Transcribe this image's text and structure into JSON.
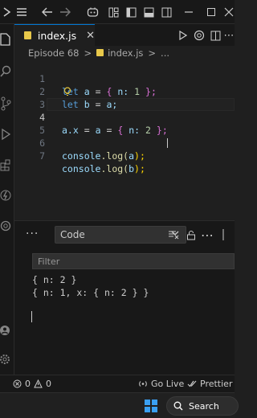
{
  "tab": {
    "filename": "index.js"
  },
  "breadcrumb": {
    "folder": "Episode 68",
    "separator": ">",
    "file": "index.js",
    "trail": "..."
  },
  "editor": {
    "lines": [
      {
        "num": "1",
        "tokens": [
          "let",
          "a",
          "=",
          "{",
          "n:",
          "1",
          "};"
        ]
      },
      {
        "num": "2",
        "tokens": [
          "let",
          "b",
          "=",
          "a;"
        ]
      },
      {
        "num": "3",
        "tokens": []
      },
      {
        "num": "4",
        "tokens": [
          "a.x",
          "=",
          "a",
          "=",
          "{",
          "n:",
          "2",
          "};"
        ]
      },
      {
        "num": "5",
        "tokens": []
      },
      {
        "num": "6",
        "tokens": [
          "console",
          ".log(",
          "a",
          ");"
        ]
      },
      {
        "num": "7",
        "tokens": [
          "console",
          ".log(",
          "b",
          ");"
        ]
      }
    ],
    "active_line": 4
  },
  "panel": {
    "dropdown_value": "Code",
    "filter_placeholder": "Filter",
    "output": [
      "{ n: 2 }",
      "{ n: 1, x: { n: 2 } }"
    ]
  },
  "statusbar": {
    "errors": "0",
    "warnings": "0",
    "golive": "Go Live",
    "prettier": "Prettier"
  },
  "taskbar": {
    "search_label": "Search"
  },
  "colors": {
    "accent": "#0078d4",
    "js_badge": "#e8c84a",
    "keyword": "#569cd6",
    "number": "#b5cea8"
  }
}
